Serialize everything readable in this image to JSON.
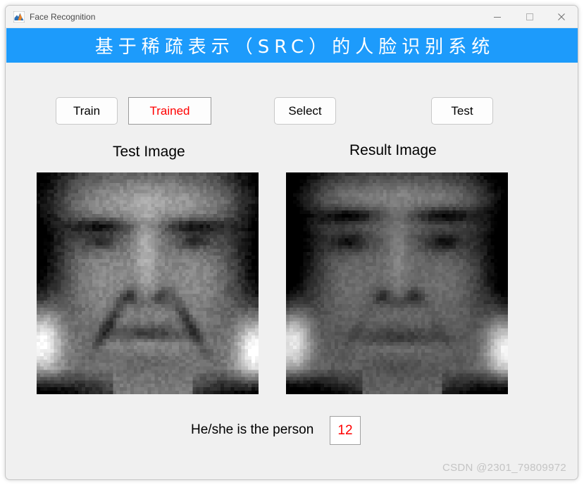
{
  "window": {
    "title": "Face Recognition",
    "icon": "matlab-icon",
    "controls": {
      "minimize": "minimize-icon",
      "maximize": "maximize-icon",
      "close": "close-icon"
    }
  },
  "banner": {
    "title": "基于稀疏表示（SRC）的人脸识别系统",
    "background_color": "#1d9bfb",
    "text_color": "#ffffff"
  },
  "toolbar": {
    "train_label": "Train",
    "trained_label": "Trained",
    "trained_color": "#ff0000",
    "select_label": "Select",
    "test_label": "Test"
  },
  "panels": {
    "test_caption": "Test Image",
    "result_caption": "Result Image"
  },
  "result": {
    "label": "He/she is the person",
    "value": "12",
    "value_color": "#ff0000"
  },
  "watermark": {
    "text": "CSDN @2301_79809972"
  }
}
